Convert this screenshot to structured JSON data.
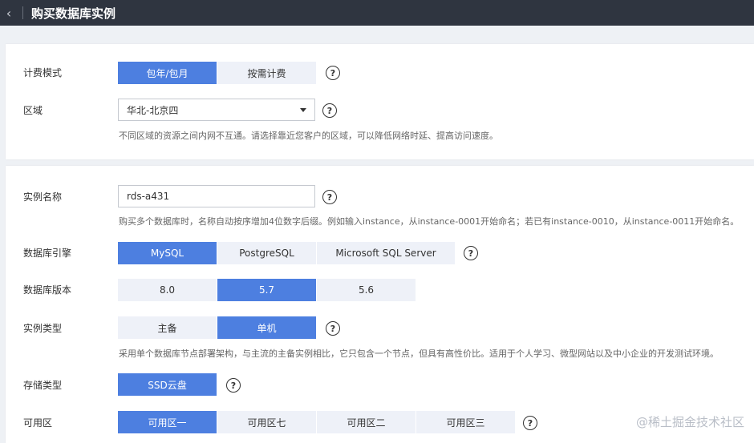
{
  "header": {
    "back_icon": "chevron-left-icon",
    "title": "购买数据库实例"
  },
  "billing": {
    "label": "计费模式",
    "options": [
      "包年/包月",
      "按需计费"
    ],
    "selected": "包年/包月",
    "help": "?"
  },
  "region": {
    "label": "区域",
    "value": "华北-北京四",
    "help": "?",
    "hint": "不同区域的资源之间内网不互通。请选择靠近您客户的区域，可以降低网络时延、提高访问速度。"
  },
  "instance_name": {
    "label": "实例名称",
    "value": "rds-a431",
    "help": "?",
    "hint": "购买多个数据库时，名称自动按序增加4位数字后缀。例如输入instance，从instance-0001开始命名；若已有instance-0010，从instance-0011开始命名。"
  },
  "engine": {
    "label": "数据库引擎",
    "options": [
      "MySQL",
      "PostgreSQL",
      "Microsoft SQL Server"
    ],
    "selected": "MySQL",
    "help": "?"
  },
  "version": {
    "label": "数据库版本",
    "options": [
      "8.0",
      "5.7",
      "5.6"
    ],
    "selected": "5.7"
  },
  "instance_type": {
    "label": "实例类型",
    "options": [
      "主备",
      "单机"
    ],
    "selected": "单机",
    "help": "?",
    "hint": "采用单个数据库节点部署架构，与主流的主备实例相比，它只包含一个节点，但具有高性价比。适用于个人学习、微型网站以及中小企业的开发测试环境。"
  },
  "storage": {
    "label": "存储类型",
    "options": [
      "SSD云盘"
    ],
    "selected": "SSD云盘",
    "help": "?"
  },
  "az": {
    "label": "可用区",
    "options": [
      "可用区一",
      "可用区七",
      "可用区二",
      "可用区三"
    ],
    "selected": "可用区一",
    "help": "?"
  },
  "watermark": "@稀土掘金技术社区",
  "colors": {
    "topbar": "#2f3540",
    "accent": "#4d7fe0",
    "segment_bg": "#eef1f8"
  }
}
